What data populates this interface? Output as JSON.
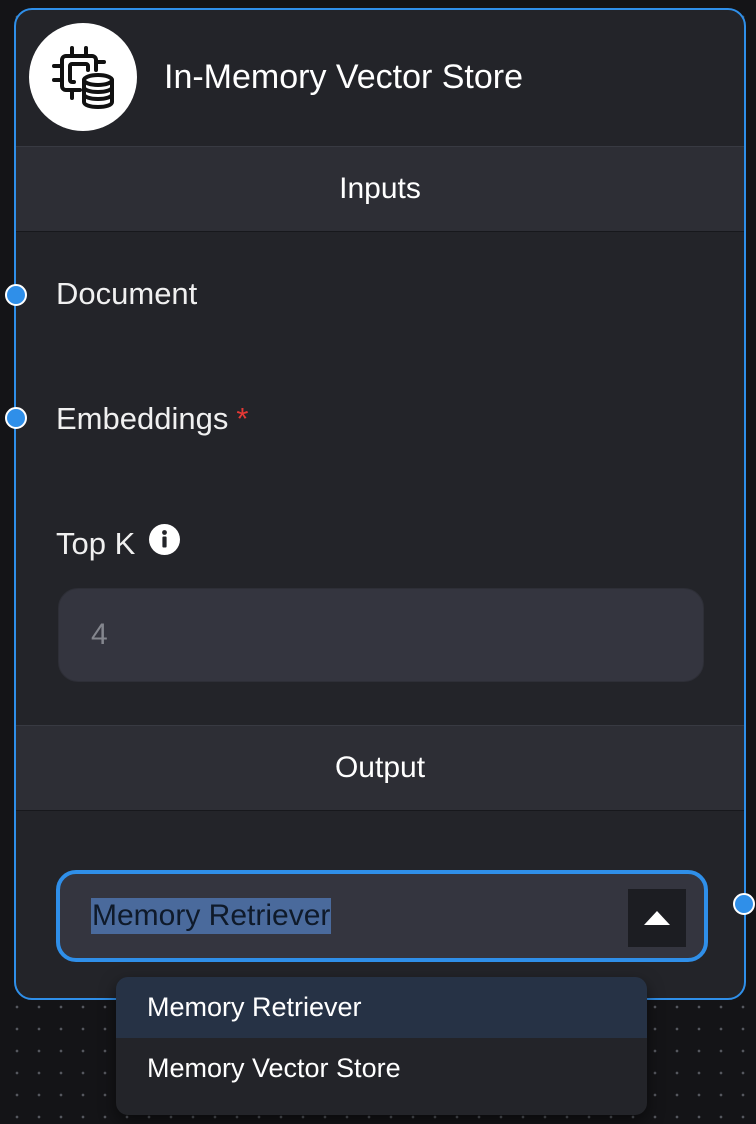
{
  "node": {
    "title": "In-Memory Vector Store",
    "icon": "chip-database-icon"
  },
  "inputs": {
    "section_label": "Inputs",
    "document_label": "Document",
    "embeddings_label": "Embeddings",
    "embeddings_required_mark": "*",
    "topk_label": "Top K",
    "topk_info_icon": "info-icon",
    "topk_placeholder": "4"
  },
  "output": {
    "section_label": "Output",
    "selected_value": "Memory Retriever",
    "toggle_icon": "caret-up-icon",
    "options": [
      {
        "label": "Memory Retriever",
        "selected": true
      },
      {
        "label": "Memory Vector Store",
        "selected": false
      }
    ]
  },
  "colors": {
    "accent": "#2f8fe9",
    "node_background": "#232429",
    "section_background": "#2d2e35",
    "required": "#e53935",
    "selection_highlight": "#4a6a9c"
  }
}
